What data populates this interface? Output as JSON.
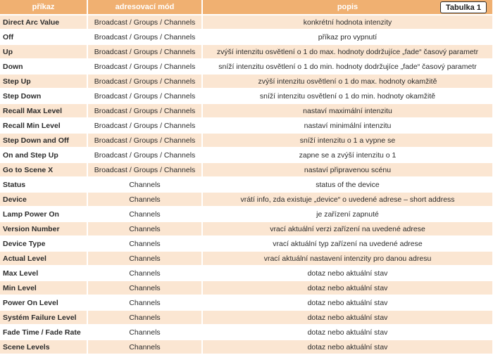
{
  "header": {
    "command": "příkaz",
    "mode": "adresovací mód",
    "description": "popis"
  },
  "badge": "Tabulka 1",
  "rows": [
    {
      "command": "Direct Arc Value",
      "mode": "Broadcast / Groups / Channels",
      "description": "konkrétní hodnota intenzity"
    },
    {
      "command": "Off",
      "mode": "Broadcast / Groups / Channels",
      "description": "příkaz pro vypnutí"
    },
    {
      "command": "Up",
      "mode": "Broadcast / Groups / Channels",
      "description": "zvýší intenzitu osvětlení o 1 do max. hodnoty dodržujíce „fade“ časový parametr"
    },
    {
      "command": "Down",
      "mode": "Broadcast / Groups / Channels",
      "description": "sníží intenzitu osvětlení o 1 do min. hodnoty dodržujíce „fade“ časový parametr"
    },
    {
      "command": "Step Up",
      "mode": "Broadcast / Groups / Channels",
      "description": "zvýší intenzitu osvětlení o 1 do max. hodnoty okamžitě"
    },
    {
      "command": "Step Down",
      "mode": "Broadcast / Groups / Channels",
      "description": "sníží intenzitu osvětlení o 1 do min. hodnoty okamžitě"
    },
    {
      "command": "Recall Max Level",
      "mode": "Broadcast / Groups / Channels",
      "description": "nastaví maximální intenzitu"
    },
    {
      "command": "Recall Min Level",
      "mode": "Broadcast / Groups / Channels",
      "description": "nastaví minimální intenzitu"
    },
    {
      "command": "Step Down and Off",
      "mode": "Broadcast / Groups / Channels",
      "description": "sníží intenzitu o 1 a vypne se"
    },
    {
      "command": "On and Step Up",
      "mode": "Broadcast / Groups / Channels",
      "description": "zapne se a zvýší intenzitu o 1"
    },
    {
      "command": "Go to Scene X",
      "mode": "Broadcast / Groups / Channels",
      "description": "nastaví připravenou scénu"
    },
    {
      "command": "Status",
      "mode": "Channels",
      "description": "status of the device"
    },
    {
      "command": "Device",
      "mode": "Channels",
      "description": "vrátí info, zda existuje „device“ o uvedené adrese – short address"
    },
    {
      "command": "Lamp Power On",
      "mode": "Channels",
      "description": "je zařízení zapnuté"
    },
    {
      "command": "Version Number",
      "mode": "Channels",
      "description": "vrací aktuální verzi zařízení na uvedené adrese"
    },
    {
      "command": "Device Type",
      "mode": "Channels",
      "description": "vrací aktuální typ zařízení na uvedené adrese"
    },
    {
      "command": "Actual Level",
      "mode": "Channels",
      "description": "vrací aktuální nastavení intenzity pro danou adresu"
    },
    {
      "command": "Max Level",
      "mode": "Channels",
      "description": "dotaz nebo aktuální stav"
    },
    {
      "command": "Min Level",
      "mode": "Channels",
      "description": "dotaz nebo aktuální stav"
    },
    {
      "command": "Power On Level",
      "mode": "Channels",
      "description": "dotaz nebo aktuální stav"
    },
    {
      "command": "Systém Failure Level",
      "mode": "Channels",
      "description": "dotaz nebo aktuální stav"
    },
    {
      "command": "Fade Time / Fade Rate",
      "mode": "Channels",
      "description": "dotaz nebo aktuální stav"
    },
    {
      "command": "Scene Levels",
      "mode": "Channels",
      "description": "dotaz nebo aktuální stav"
    }
  ]
}
